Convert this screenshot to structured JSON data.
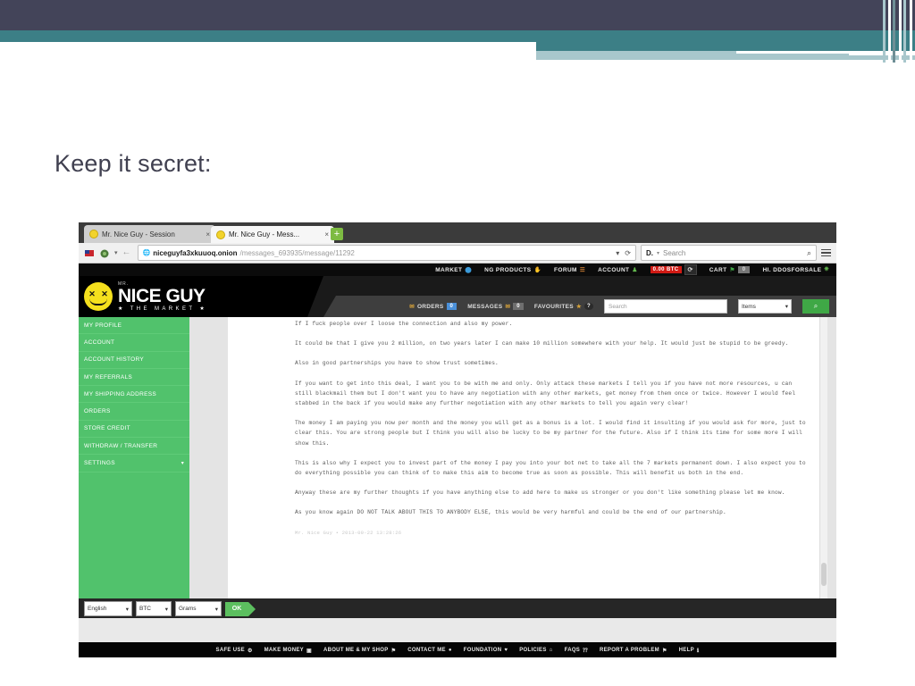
{
  "slide": {
    "title": "Keep it secret:"
  },
  "browser": {
    "tabs": [
      {
        "label": "Mr. Nice Guy - Session",
        "active": false
      },
      {
        "label": "Mr. Nice Guy - Mess...",
        "active": true
      }
    ],
    "new_tab_label": "+",
    "close_label": "×",
    "url_host": "niceguyfa3xkuuoq.onion",
    "url_path": "/messages_693935/message/11292",
    "url_scheme_icon": "globe-icon",
    "reload_icon": "⟳",
    "back_icon": "←",
    "search_engine": "D.",
    "search_placeholder": "Search",
    "search_icon": "⌕",
    "menu_icon": "hamburger-icon"
  },
  "site": {
    "topnav": [
      {
        "label": "MARKET",
        "icon": "⬤"
      },
      {
        "label": "NG PRODUCTS",
        "icon": "✋"
      },
      {
        "label": "FORUM",
        "icon": "☰"
      },
      {
        "label": "ACCOUNT",
        "icon": "♟"
      }
    ],
    "btc_balance": "0.00 BTC",
    "refresh_icon": "⟳",
    "cart_label": "CART",
    "cart_icon": "⚑",
    "cart_count": "0",
    "user_greeting": "HI. DDOSFORSALE",
    "user_icon": "⎈",
    "logo": {
      "pre": "MR.",
      "name": "NICE GUY",
      "tagline": "★ THE MARKET ★",
      "face_icon": "dead-smiley-icon",
      "eye_left": "✕",
      "eye_right": "✕"
    },
    "subnav": [
      {
        "label": "ORDERS",
        "icon": "✉",
        "badge": "0",
        "badge_color": "blue"
      },
      {
        "label": "MESSAGES",
        "icon": "✉",
        "badge": "0",
        "badge_color": "gray"
      },
      {
        "label": "FAVOURITES",
        "icon": "★",
        "badge": "?",
        "badge_color": "dark"
      }
    ],
    "search_placeholder": "Search",
    "search_scope": "Items",
    "search_scope_caret": "▾",
    "search_button_icon": "⌕",
    "sidebar": [
      {
        "label": "MY PROFILE"
      },
      {
        "label": "ACCOUNT"
      },
      {
        "label": "ACCOUNT HISTORY"
      },
      {
        "label": "MY REFERRALS"
      },
      {
        "label": "MY SHIPPING ADDRESS"
      },
      {
        "label": "ORDERS"
      },
      {
        "label": "STORE CREDIT"
      },
      {
        "label": "WITHDRAW / TRANSFER"
      },
      {
        "label": "SETTINGS",
        "caret": "▾"
      }
    ],
    "message": {
      "p1": "If I fuck people over I loose the connection and also my power.",
      "p2": "It could be that I give you 2 million, on two years later I can make 10 million somewhere with your help. It would just be stupid to be greedy.",
      "p3": "Also in good partnerships you have to show trust sometimes.",
      "p4": "If you want to get into this deal, I want you to be with me and only. Only attack these markets I tell you if you have not more resources, u can still blackmail them but I don't want you to have any negotiation with any other markets, get money from them once or twice. However I would feel stabbed in the back if you would make any further negotiation with any other markets to tell you again very clear!",
      "p5": "The money I am paying you now per month and the money you will get as a bonus is a lot. I would find it insulting if you would ask for more, just to clear this. You are strong people but I think you will also be lucky to be my partner for the future. Also if I think its time for some more I will show this.",
      "p6": "This is also why I expect you to invest part of the money I pay you into your bot net to take all the 7 markets permanent down. I also expect you to do everything possible you can think of to make this aim to become true as soon as possible. This will benefit us both in the end.",
      "p7": "Anyway these are my further thoughts if you have anything else to add here to make us stronger or you don't like something please let me know.",
      "p8": "As you know again DO NOT TALK ABOUT THIS TO ANYBODY ELSE, this would be very harmful and could be the end of our partnership.",
      "signature": "Mr. Nice Guy • 2013-09-22 13:28:26"
    },
    "bottom_selects": [
      {
        "value": "English",
        "caret": "▾"
      },
      {
        "value": "BTC",
        "caret": "▾"
      },
      {
        "value": "Grams",
        "caret": "▾"
      }
    ],
    "ok_label": "OK",
    "footer": [
      {
        "label": "SAFE USE",
        "icon": "⚙"
      },
      {
        "label": "MAKE MONEY",
        "icon": "▣"
      },
      {
        "label": "ABOUT ME & MY SHOP",
        "icon": "⚑"
      },
      {
        "label": "CONTACT ME",
        "icon": "●"
      },
      {
        "label": "FOUNDATION",
        "icon": "♥"
      },
      {
        "label": "POLICIES",
        "icon": "⌂"
      },
      {
        "label": "FAQS",
        "icon": "⁇"
      },
      {
        "label": "REPORT A PROBLEM",
        "icon": "⚑"
      },
      {
        "label": "HELP",
        "icon": "ℹ"
      }
    ]
  },
  "colors": {
    "banner_dark": "#434459",
    "banner_teal": "#3c7f86",
    "banner_light": "#a8c7cc",
    "sidebar_green": "#51c26c",
    "accent_green": "#3fa846",
    "btc_red": "#d11a14",
    "badge_blue": "#4a90d9"
  }
}
